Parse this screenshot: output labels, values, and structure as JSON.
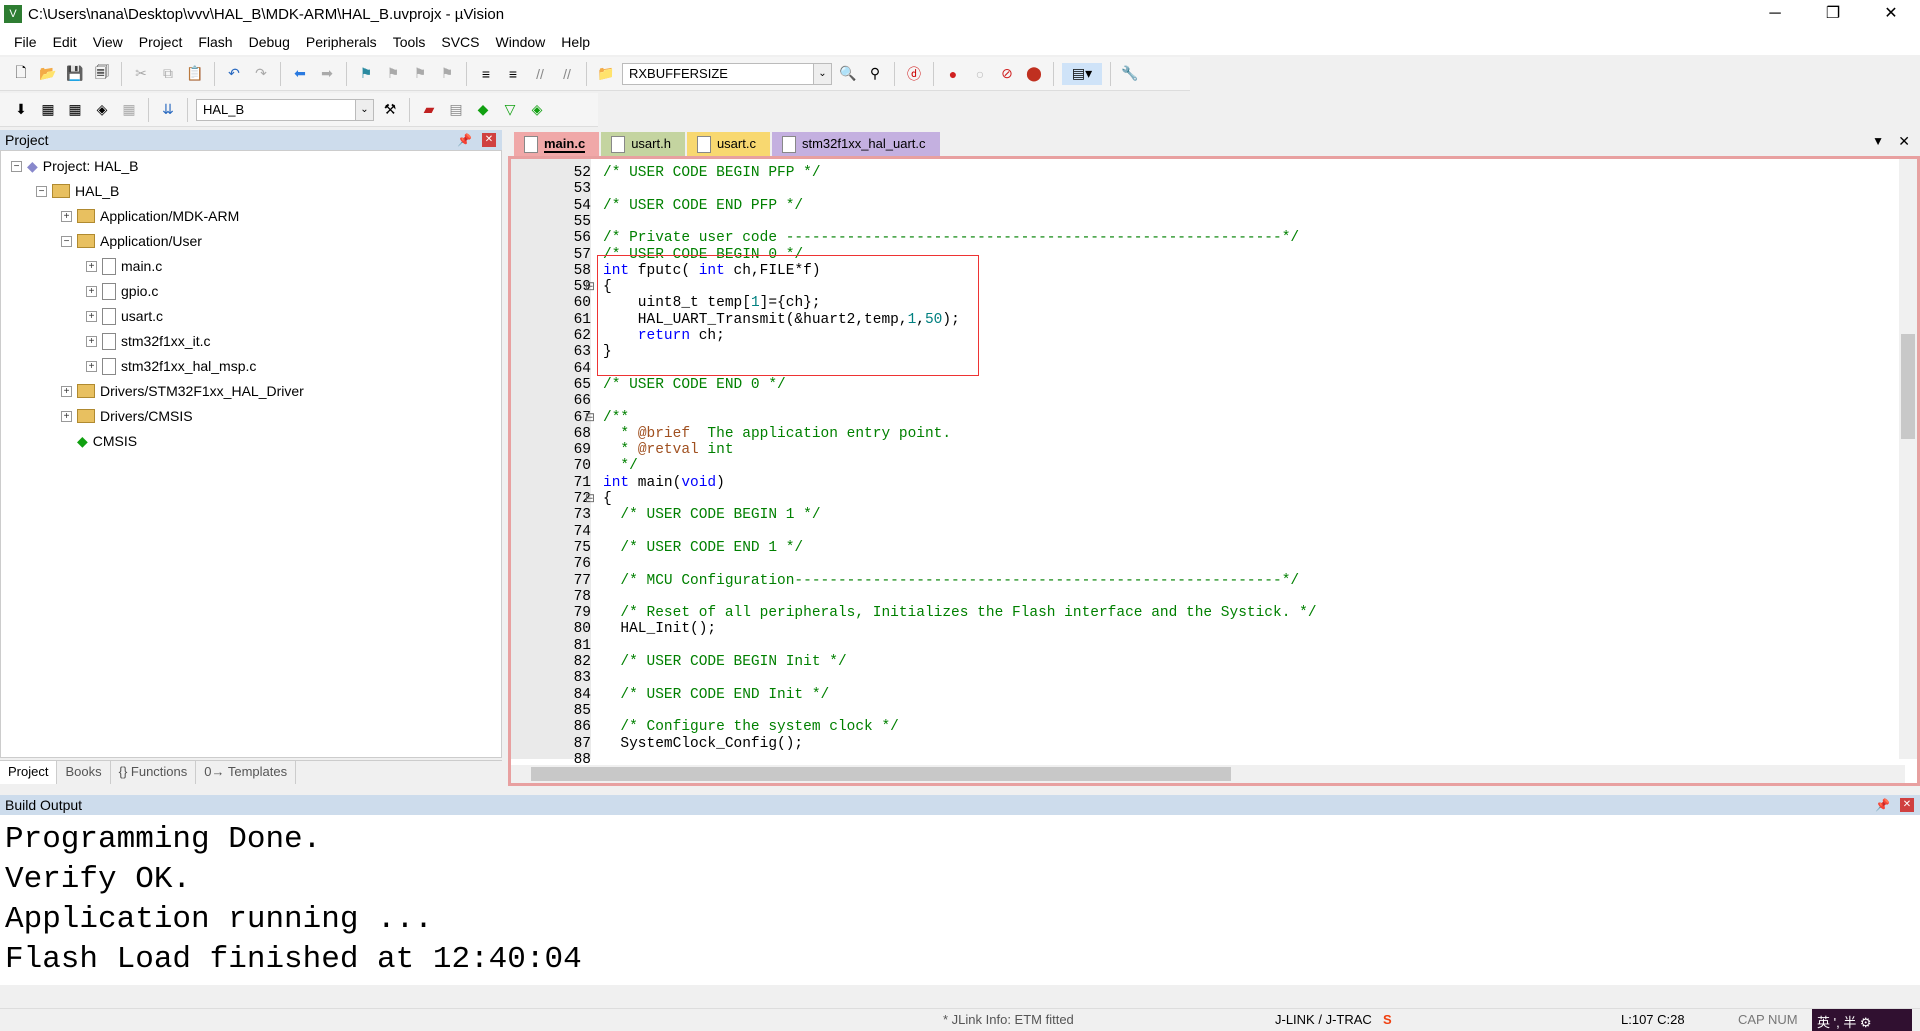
{
  "window": {
    "title": "C:\\Users\\nana\\Desktop\\vvv\\HAL_B\\MDK-ARM\\HAL_B.uvprojx - µVision",
    "minimize": "─",
    "restore": "❐",
    "close": "✕"
  },
  "menu": [
    "File",
    "Edit",
    "View",
    "Project",
    "Flash",
    "Debug",
    "Peripherals",
    "Tools",
    "SVCS",
    "Window",
    "Help"
  ],
  "toolbar": {
    "find_combo": "RXBUFFERSIZE",
    "target_combo": "HAL_B"
  },
  "project_panel": {
    "title": "Project",
    "tree": [
      {
        "label": "Project: HAL_B",
        "level": 0,
        "exp": "−",
        "kind": "project"
      },
      {
        "label": "HAL_B",
        "level": 1,
        "exp": "−",
        "kind": "target"
      },
      {
        "label": "Application/MDK-ARM",
        "level": 2,
        "exp": "+",
        "kind": "folder"
      },
      {
        "label": "Application/User",
        "level": 2,
        "exp": "−",
        "kind": "folder"
      },
      {
        "label": "main.c",
        "level": 3,
        "exp": "+",
        "kind": "file"
      },
      {
        "label": "gpio.c",
        "level": 3,
        "exp": "+",
        "kind": "file"
      },
      {
        "label": "usart.c",
        "level": 3,
        "exp": "+",
        "kind": "file"
      },
      {
        "label": "stm32f1xx_it.c",
        "level": 3,
        "exp": "+",
        "kind": "file"
      },
      {
        "label": "stm32f1xx_hal_msp.c",
        "level": 3,
        "exp": "+",
        "kind": "file"
      },
      {
        "label": "Drivers/STM32F1xx_HAL_Driver",
        "level": 2,
        "exp": "+",
        "kind": "folder"
      },
      {
        "label": "Drivers/CMSIS",
        "level": 2,
        "exp": "+",
        "kind": "folder"
      },
      {
        "label": "CMSIS",
        "level": 2,
        "exp": "",
        "kind": "component"
      }
    ],
    "tabs": [
      "Project",
      "Books",
      "{} Functions",
      "0→ Templates"
    ]
  },
  "editor": {
    "tabs": [
      {
        "label": "main.c",
        "color": "#f0a8a8",
        "active": true
      },
      {
        "label": "usart.h",
        "color": "#c4d4a0"
      },
      {
        "label": "usart.c",
        "color": "#f8d870"
      },
      {
        "label": "stm32f1xx_hal_uart.c",
        "color": "#c4b0e0"
      }
    ],
    "lines": [
      [
        52,
        [
          [
            "/* USER CODE BEGIN PFP */",
            "c"
          ]
        ]
      ],
      [
        53,
        []
      ],
      [
        54,
        [
          [
            "/* USER CODE END PFP */",
            "c"
          ]
        ]
      ],
      [
        55,
        []
      ],
      [
        56,
        [
          [
            "/* Private user code ---------------------------------------------------------*/",
            "c"
          ]
        ]
      ],
      [
        57,
        [
          [
            "/* USER CODE BEGIN 0 */",
            "c"
          ]
        ]
      ],
      [
        58,
        [
          [
            "int",
            "k"
          ],
          [
            " fputc( ",
            ""
          ],
          [
            "int",
            "k"
          ],
          [
            " ch,FILE*f)",
            ""
          ]
        ]
      ],
      [
        59,
        [
          [
            "{",
            ""
          ]
        ]
      ],
      [
        60,
        [
          [
            "    uint8_t temp[",
            ""
          ],
          [
            "1",
            "n"
          ],
          [
            "]={ch};",
            ""
          ]
        ]
      ],
      [
        61,
        [
          [
            "    HAL_UART_Transmit(&huart2,temp,",
            ""
          ],
          [
            "1",
            "n"
          ],
          [
            ",",
            ""
          ],
          [
            "50",
            "n"
          ],
          [
            ");",
            ""
          ]
        ]
      ],
      [
        62,
        [
          [
            "    ",
            ""
          ],
          [
            "return",
            "k"
          ],
          [
            " ch;",
            ""
          ]
        ]
      ],
      [
        63,
        [
          [
            "}",
            ""
          ]
        ]
      ],
      [
        64,
        []
      ],
      [
        65,
        [
          [
            "/* USER CODE END 0 */",
            "c"
          ]
        ]
      ],
      [
        66,
        []
      ],
      [
        67,
        [
          [
            "/**",
            "c"
          ]
        ]
      ],
      [
        68,
        [
          [
            "  * ",
            "c"
          ],
          [
            "@brief",
            "d"
          ],
          [
            "  The application entry point.",
            "c"
          ]
        ]
      ],
      [
        69,
        [
          [
            "  * ",
            "c"
          ],
          [
            "@retval",
            "d"
          ],
          [
            " int",
            "c"
          ]
        ]
      ],
      [
        70,
        [
          [
            "  */",
            "c"
          ]
        ]
      ],
      [
        71,
        [
          [
            "int",
            "k"
          ],
          [
            " main(",
            ""
          ],
          [
            "void",
            "k"
          ],
          [
            ")",
            ""
          ]
        ]
      ],
      [
        72,
        [
          [
            "{",
            ""
          ]
        ]
      ],
      [
        73,
        [
          [
            "  /* USER CODE BEGIN 1 */",
            "c"
          ]
        ]
      ],
      [
        74,
        []
      ],
      [
        75,
        [
          [
            "  /* USER CODE END 1 */",
            "c"
          ]
        ]
      ],
      [
        76,
        []
      ],
      [
        77,
        [
          [
            "  /* MCU Configuration--------------------------------------------------------*/",
            "c"
          ]
        ]
      ],
      [
        78,
        []
      ],
      [
        79,
        [
          [
            "  /* Reset of all peripherals, Initializes the Flash interface and the Systick. */",
            "c"
          ]
        ]
      ],
      [
        80,
        [
          [
            "  HAL_Init();",
            ""
          ]
        ]
      ],
      [
        81,
        []
      ],
      [
        82,
        [
          [
            "  /* USER CODE BEGIN Init */",
            "c"
          ]
        ]
      ],
      [
        83,
        []
      ],
      [
        84,
        [
          [
            "  /* USER CODE END Init */",
            "c"
          ]
        ]
      ],
      [
        85,
        []
      ],
      [
        86,
        [
          [
            "  /* Configure the system clock */",
            "c"
          ]
        ]
      ],
      [
        87,
        [
          [
            "  SystemClock_Config();",
            ""
          ]
        ]
      ],
      [
        88,
        []
      ]
    ]
  },
  "build_output": {
    "title": "Build Output",
    "lines": [
      "Programming Done.",
      "Verify OK.",
      "Application running ...",
      "Flash Load finished at 12:40:04"
    ]
  },
  "status": {
    "info": "* JLink Info: ETM fitted",
    "debugger": "J-LINK / J-TRAC",
    "position": "L:107 C:28",
    "cap": "CAP",
    "num": "NUM",
    "ime": "英 ', 半 ⚙"
  }
}
